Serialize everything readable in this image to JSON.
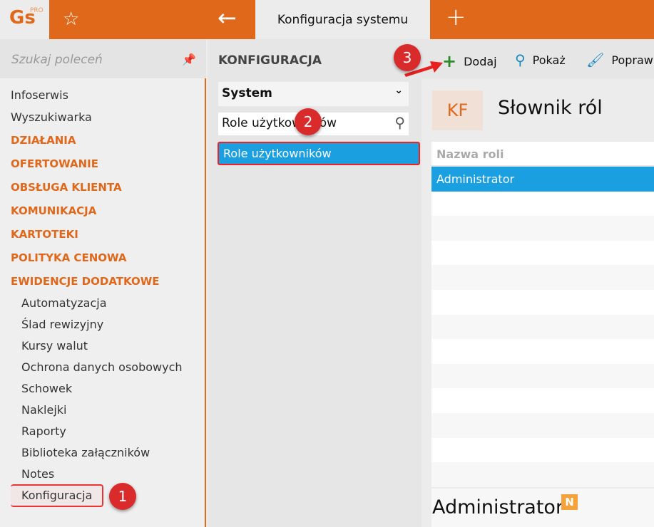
{
  "header": {
    "logo": "Gs",
    "logo_sup": "PRO",
    "active_tab": "Konfiguracja systemu"
  },
  "sidebar": {
    "search_placeholder": "Szukaj poleceń",
    "items": [
      "Infoserwis",
      "Wyszukiwarka"
    ],
    "categories": [
      "DZIAŁANIA",
      "OFERTOWANIE",
      "OBSŁUGA KLIENTA",
      "KOMUNIKACJA",
      "KARTOTEKI",
      "POLITYKA CENOWA",
      "EWIDENCJE DODATKOWE"
    ],
    "subitems": [
      "Automatyzacja",
      "Ślad rewizyjny",
      "Kursy walut",
      "Ochrona danych osobowych",
      "Schowek",
      "Naklejki",
      "Raporty",
      "Biblioteka załączników",
      "Notes",
      "Konfiguracja"
    ]
  },
  "middle": {
    "title": "KONFIGURACJA",
    "select_value": "System",
    "search_value": "Role użytkowników",
    "results": [
      "Role użytkowników"
    ]
  },
  "toolbar": {
    "add": "Dodaj",
    "show": "Pokaż",
    "edit": "Popraw"
  },
  "main": {
    "badge": "KF",
    "title": "Słownik ról",
    "column": "Nazwa roli",
    "rows": [
      "Administrator"
    ],
    "detail_title": "Administrator",
    "detail_badge": "N"
  },
  "annotations": [
    "1",
    "2",
    "3"
  ],
  "colors": {
    "accent": "#e0681a",
    "selection": "#1a9fe0",
    "marker": "#d92b2b"
  }
}
